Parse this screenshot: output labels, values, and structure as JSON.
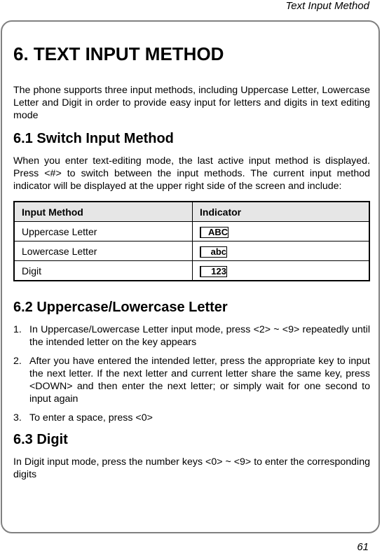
{
  "running_header": "Text Input Method",
  "chapter_title": "6. TEXT INPUT METHOD",
  "intro": "The phone supports three input methods, including Uppercase Letter, Lowercase Letter and Digit in order to provide easy input for letters and digits in text editing mode",
  "sections": [
    {
      "title": "6.1 Switch Input Method",
      "body": "When you enter text-editing mode, the last active input method is displayed. Press <#> to switch between the input methods. The current input method indicator will be displayed at the upper right side of the screen and include:"
    },
    {
      "title": "6.2 Uppercase/Lowercase Letter",
      "items": [
        {
          "num": "1.",
          "text": "In Uppercase/Lowercase Letter input mode, press <2> ~ <9> repeatedly until the intended letter on the key appears"
        },
        {
          "num": "2.",
          "text": "After you have entered the intended letter, press the appropriate key to input the next letter. If the next letter and current letter share the same key, press <DOWN> and then enter the next letter; or simply wait for one second to input again"
        },
        {
          "num": "3.",
          "text": "To enter a space, press <0>"
        }
      ]
    },
    {
      "title": "6.3 Digit",
      "body": "In Digit input mode, press the number keys <0> ~ <9> to enter the corresponding digits"
    }
  ],
  "table": {
    "headers": [
      "Input Method",
      "Indicator"
    ],
    "rows": [
      {
        "method": "Uppercase Letter",
        "indicator": "ABC"
      },
      {
        "method": "Lowercase Letter",
        "indicator": "abc"
      },
      {
        "method": "Digit",
        "indicator": "123"
      }
    ]
  },
  "page_number": "61"
}
